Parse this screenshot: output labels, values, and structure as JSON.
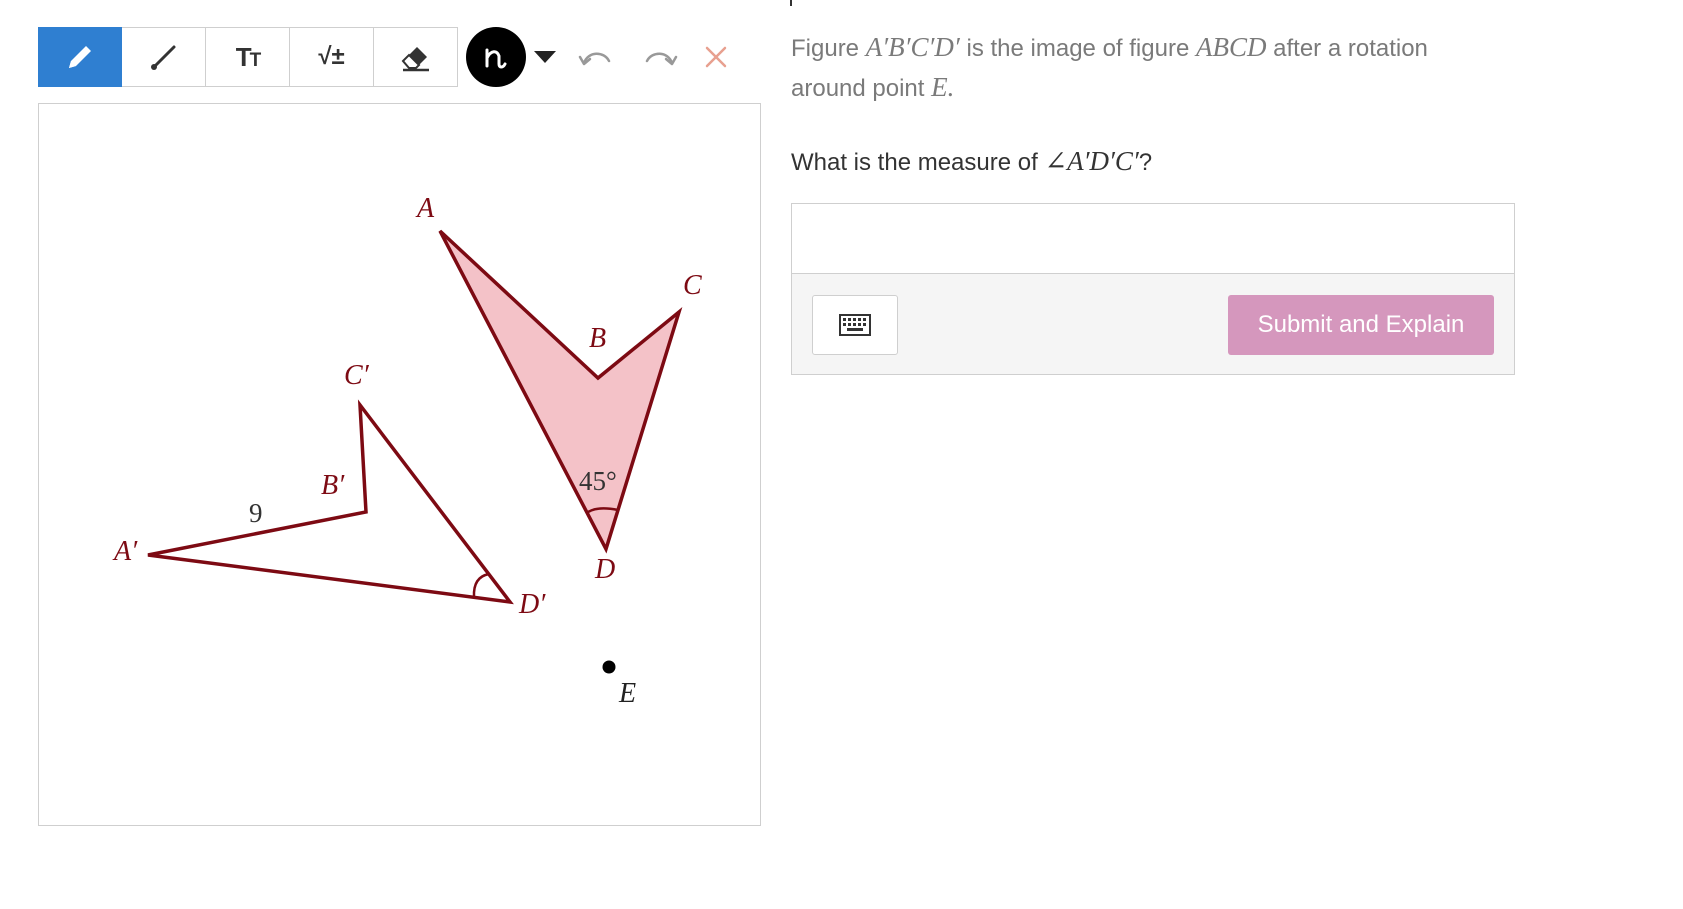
{
  "toolbar": {
    "tools": [
      {
        "name": "pencil",
        "icon": "pencil-icon",
        "active": true
      },
      {
        "name": "line",
        "icon": "line-icon",
        "active": false
      },
      {
        "name": "text",
        "icon": "text-size-icon",
        "label_big": "T",
        "label_small": "T",
        "active": false
      },
      {
        "name": "math",
        "icon": "math-symbol-icon",
        "label": "√±",
        "active": false
      },
      {
        "name": "eraser",
        "icon": "eraser-icon",
        "active": false
      }
    ],
    "color_icon": "squiggle-icon",
    "current_color": "#000000",
    "undo_icon": "undo-icon",
    "redo_icon": "redo-icon",
    "clear_icon": "close-icon",
    "clear_color": "#e8a08f",
    "active_color": "#2f7fd1"
  },
  "figure": {
    "stroke_color": "#7d0a13",
    "fill_color": "#f4c2c8",
    "labels": {
      "A": "A",
      "B": "B",
      "C": "C",
      "D": "D",
      "E": "E",
      "A_prime": "A′",
      "B_prime": "B′",
      "C_prime": "C′",
      "D_prime": "D′"
    },
    "angle_label": "45°",
    "side_label": "9"
  },
  "question": {
    "intro_1": "Figure",
    "figure_image": "A′B′C′D′",
    "intro_2": "is the image of figure",
    "figure_orig": "ABCD",
    "intro_3": "after a rotation",
    "line2_text": "around point",
    "point": "E",
    "line2_end": ".",
    "prompt_pre": "What is the measure of",
    "prompt_angle": "∠A′D′C′",
    "prompt_post": "?"
  },
  "answer": {
    "input_value": "",
    "keyboard_icon": "keyboard-icon",
    "submit_label": "Submit and Explain",
    "submit_color": "#d597bd"
  }
}
